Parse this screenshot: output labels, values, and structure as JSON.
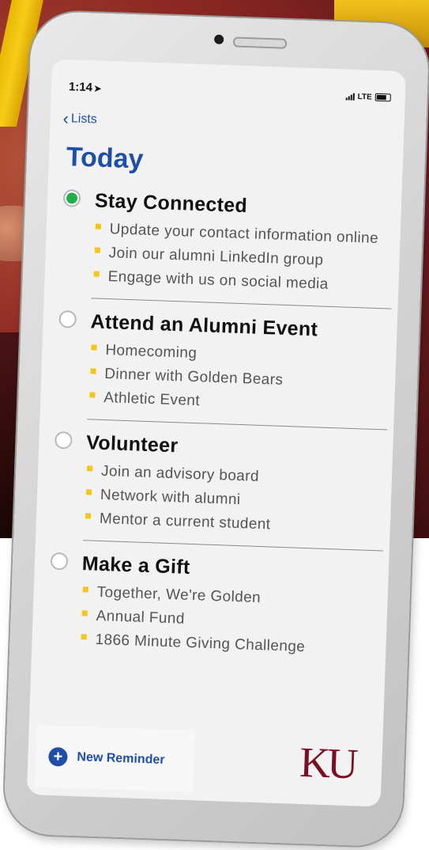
{
  "status_bar": {
    "time": "1:14",
    "location_arrow": "➤",
    "network": "LTE"
  },
  "nav": {
    "back_label": "Lists"
  },
  "page": {
    "title": "Today"
  },
  "groups": [
    {
      "title": "Stay Connected",
      "checked": true,
      "items": [
        "Update your contact information online",
        "Join our alumni LinkedIn group",
        "Engage with us on social media"
      ]
    },
    {
      "title": "Attend an Alumni Event",
      "checked": false,
      "items": [
        "Homecoming",
        "Dinner with Golden Bears",
        "Athletic Event"
      ]
    },
    {
      "title": "Volunteer",
      "checked": false,
      "items": [
        "Join an advisory board",
        "Network with alumni",
        "Mentor a current student"
      ]
    },
    {
      "title": "Make a Gift",
      "checked": false,
      "items": [
        "Together, We're Golden",
        "Annual Fund",
        "1866 Minute Giving Challenge"
      ]
    }
  ],
  "footer": {
    "new_reminder_label": "New Reminder",
    "logo_text": "KU"
  },
  "colors": {
    "accent_blue": "#1e4ea8",
    "checked_green": "#1fb04b",
    "bullet_gold": "#f5c518",
    "logo_maroon": "#7a0f23"
  }
}
